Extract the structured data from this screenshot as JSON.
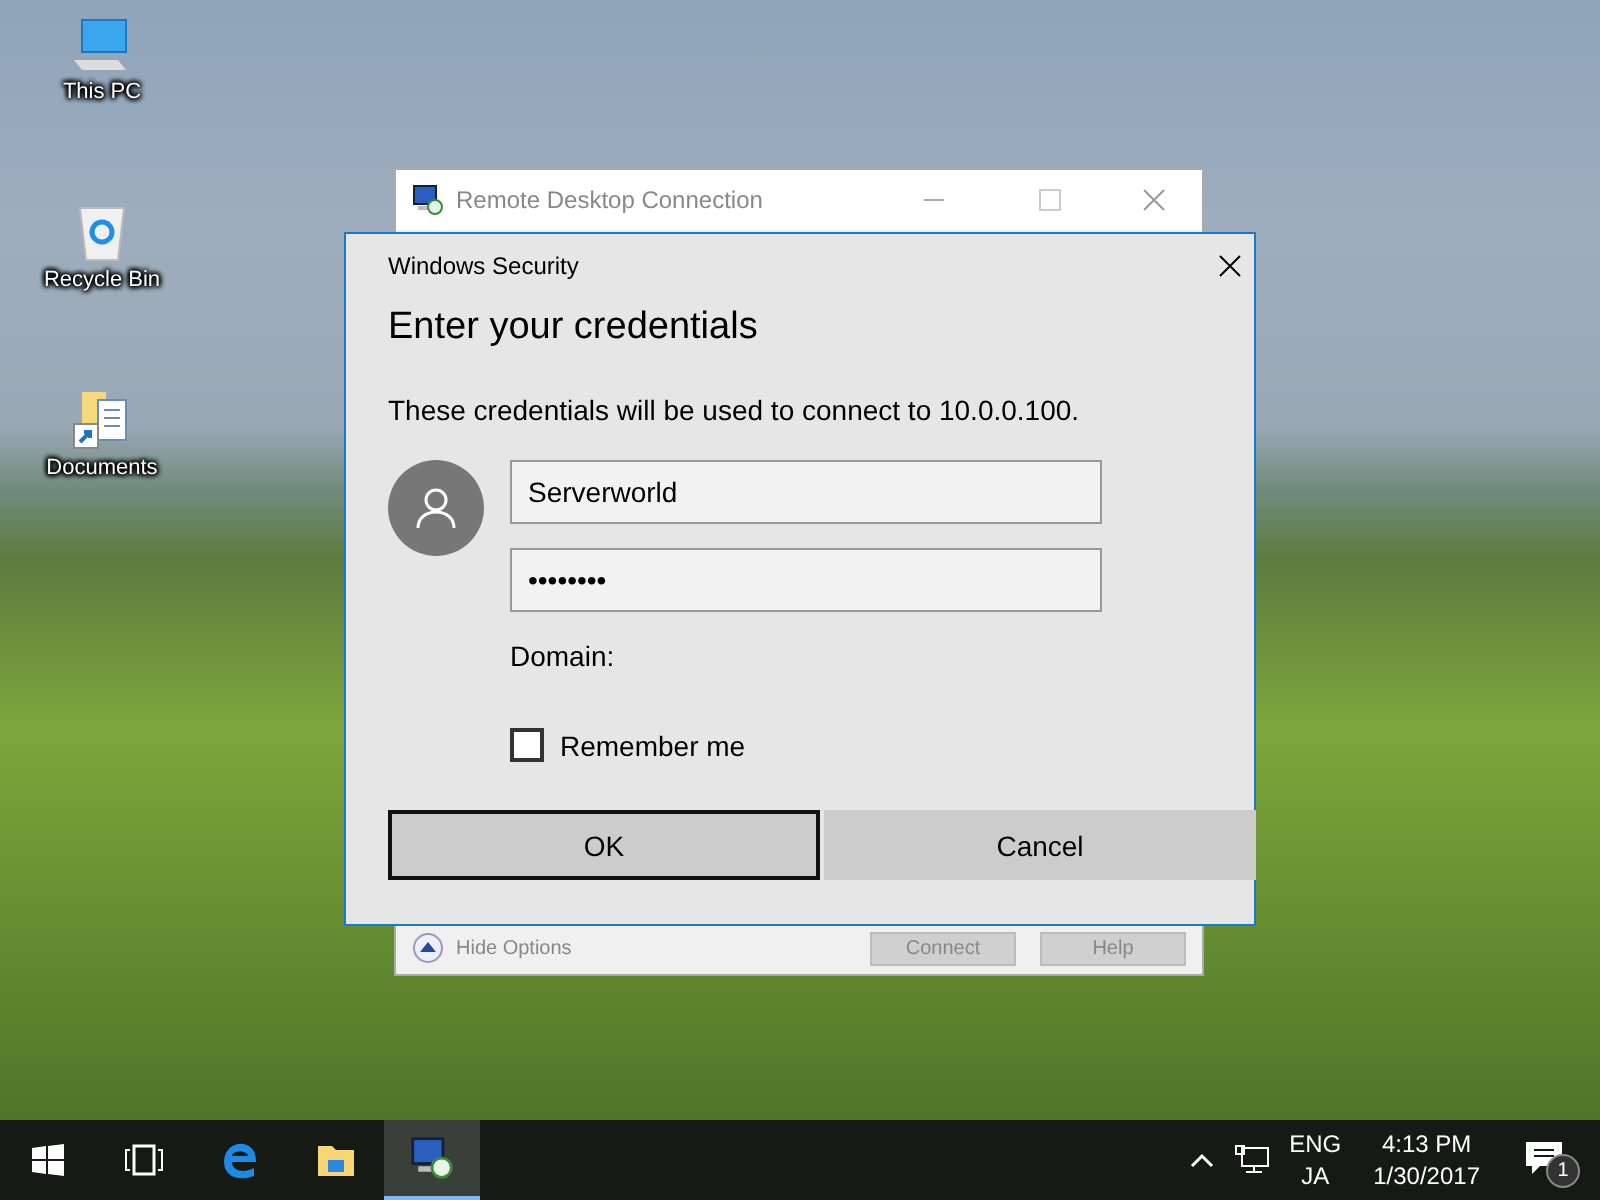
{
  "desktop_icons": [
    {
      "kind": "computer",
      "label": "This PC"
    },
    {
      "kind": "recycle",
      "label": "Recycle Bin"
    },
    {
      "kind": "documents",
      "label": "Documents"
    }
  ],
  "rdc_window": {
    "title": "Remote Desktop Connection",
    "hide_options": "Hide Options",
    "buttons": [
      "Connect",
      "Help"
    ]
  },
  "security_dialog": {
    "title": "Windows Security",
    "heading": "Enter your credentials",
    "message": "These credentials will be used to connect to 10.0.0.100.",
    "username": "Serverworld",
    "password": "••••••••",
    "domain_label": "Domain:",
    "remember": {
      "label": "Remember me",
      "checked": false
    },
    "buttons": [
      {
        "label": "OK",
        "selected": true
      },
      {
        "label": "Cancel",
        "selected": false
      }
    ]
  },
  "taskbar": {
    "language": "ENG",
    "input_mode": "JA",
    "time": "4:13 PM",
    "date": "1/30/2017",
    "notification_count": "1"
  }
}
